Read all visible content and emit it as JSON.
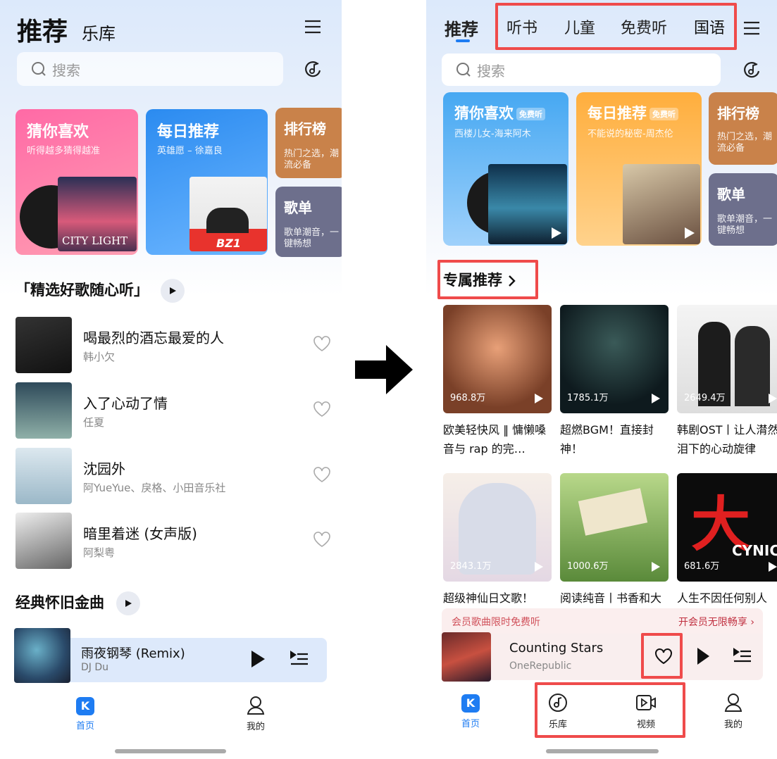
{
  "left": {
    "header": {
      "title": "推荐",
      "subtab": "乐库"
    },
    "search": {
      "placeholder": "搜索"
    },
    "cards": [
      {
        "title": "猜你喜欢",
        "subtitle": "听得越多猜得越准",
        "cover_text": "CITY LIGHT"
      },
      {
        "title": "每日推荐",
        "subtitle": "英雄愿 – 徐嘉良",
        "cover_text": "BZ1"
      },
      {
        "title": "排行榜",
        "subtitle": "热门之选，潮流必备"
      },
      {
        "title": "歌单",
        "subtitle": "歌单潮音，一键畅想"
      }
    ],
    "section1": "「精选好歌随心听」",
    "songs": [
      {
        "title": "喝最烈的酒忘最爱的人",
        "artist": "韩小欠"
      },
      {
        "title": "入了心动了情",
        "artist": "任夏"
      },
      {
        "title": "沈园外",
        "artist": "阿YueYue、戾格、小田音乐社"
      },
      {
        "title": "暗里着迷 (女声版)",
        "artist": "阿梨粤"
      }
    ],
    "section2": "经典怀旧金曲",
    "player": {
      "title": "雨夜钢琴 (Remix)",
      "artist": "DJ Du"
    },
    "nav": [
      {
        "label": "首页"
      },
      {
        "label": "我的"
      }
    ]
  },
  "right": {
    "tabs": [
      "推荐",
      "听书",
      "儿童",
      "免费听",
      "国语"
    ],
    "search": {
      "placeholder": "搜索"
    },
    "cards": [
      {
        "title": "猜你喜欢",
        "badge": "免费听",
        "subtitle": "西楼儿女-海来阿木"
      },
      {
        "title": "每日推荐",
        "badge": "免费听",
        "subtitle": "不能说的秘密-周杰伦"
      },
      {
        "title": "排行榜",
        "subtitle": "热门之选，潮流必备"
      },
      {
        "title": "歌单",
        "subtitle": "歌单潮音，一键畅想"
      }
    ],
    "section": "专属推荐",
    "playlists": [
      {
        "count": "968.8万",
        "caption": "欧美轻快风 ‖ 慵懒嗓音与 rap 的完…"
      },
      {
        "count": "1785.1万",
        "caption": "超燃BGM！直接封神！"
      },
      {
        "count": "2649.4万",
        "caption": "韩剧OST丨让人潸然泪下的心动旋律"
      },
      {
        "count": "2843.1万",
        "caption": "超级神仙日文歌！"
      },
      {
        "count": "1000.6万",
        "caption": "阅读纯音丨书香和大自然的双重滋养"
      },
      {
        "count": "681.6万",
        "caption": "人生不因任何别人"
      }
    ],
    "tile_text": {
      "cynic": "CYNIC",
      "big": "大"
    },
    "promo": {
      "left": "会员歌曲限时免费听",
      "right": "开会员无限畅享 ›"
    },
    "player": {
      "title": "Counting Stars",
      "artist": "OneRepublic"
    },
    "nav": [
      {
        "label": "首页"
      },
      {
        "label": "乐库"
      },
      {
        "label": "视频"
      },
      {
        "label": "我的"
      }
    ]
  },
  "colors": {
    "accent": "#1e7cf2",
    "highlight": "#ef4b4b"
  }
}
